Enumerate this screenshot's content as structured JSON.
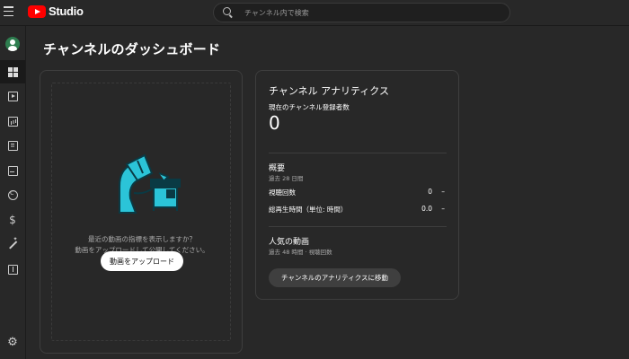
{
  "app": {
    "logo_text": "Studio"
  },
  "search": {
    "placeholder": "チャンネル内で検索"
  },
  "sidebar": {
    "items": [
      {
        "icon": "account-avatar-icon"
      },
      {
        "icon": "dashboard-icon"
      },
      {
        "icon": "content-icon"
      },
      {
        "icon": "analytics-icon"
      },
      {
        "icon": "comments-icon"
      },
      {
        "icon": "subtitles-icon"
      },
      {
        "icon": "copyright-icon"
      },
      {
        "icon": "earn-dollar-icon"
      },
      {
        "icon": "customization-wand-icon"
      },
      {
        "icon": "audio-library-icon"
      },
      {
        "icon": "settings-gear-icon"
      }
    ]
  },
  "page": {
    "title": "チャンネルのダッシュボード"
  },
  "upload_card": {
    "prompt_line1": "最近の動画の指標を表示しますか？",
    "prompt_line2": "動画をアップロードして公開してください。",
    "upload_button": "動画をアップロード"
  },
  "analytics_card": {
    "title": "チャンネル アナリティクス",
    "subscribers_label": "現在のチャンネル登録者数",
    "subscribers_value": "0",
    "summary": {
      "title": "概要",
      "period": "過去 28 日間",
      "metrics": [
        {
          "label": "視聴回数",
          "value": "0",
          "trend": "–"
        },
        {
          "label": "総再生時間（単位: 時間）",
          "value": "0.0",
          "trend": "–"
        }
      ]
    },
    "top_videos": {
      "title": "人気の動画",
      "period": "過去 48 時間 · 視聴回数"
    },
    "go_button": "チャンネルのアナリティクスに移動"
  },
  "colors": {
    "brand_red": "#ff0000",
    "illustration_cyan": "#2bc4d8",
    "background": "#282828"
  }
}
